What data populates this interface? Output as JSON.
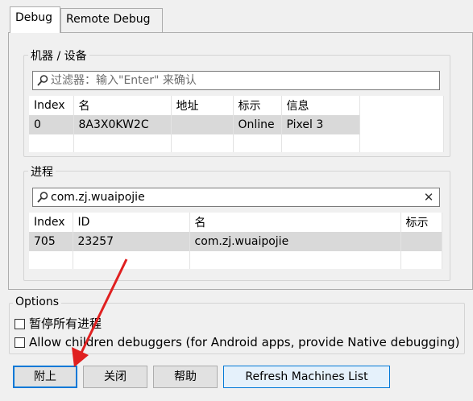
{
  "tabs": [
    {
      "label": "Debug",
      "active": true
    },
    {
      "label": "Remote Debug",
      "active": false
    }
  ],
  "machines": {
    "title": "机器 / 设备",
    "filter_placeholder": "过滤器：输入\"Enter\" 来确认",
    "columns": [
      "Index",
      "名",
      "地址",
      "标示",
      "信息"
    ],
    "rows": [
      {
        "index": "0",
        "name": "8A3X0KW2C",
        "address": "",
        "mark": "Online",
        "info": "Pixel 3"
      }
    ]
  },
  "processes": {
    "title": "进程",
    "filter_value": "com.zj.wuaipojie",
    "columns": [
      "Index",
      "ID",
      "名",
      "标示"
    ],
    "rows": [
      {
        "index": "705",
        "id": "23257",
        "name": "com.zj.wuaipojie",
        "mark": ""
      }
    ]
  },
  "options": {
    "title": "Options",
    "pause_all": {
      "label": "暂停所有进程",
      "checked": false
    },
    "allow_children": {
      "label": "Allow children debuggers (for Android apps, provide Native debugging)",
      "checked": false
    }
  },
  "buttons": {
    "attach": "附上",
    "close": "关闭",
    "help": "帮助",
    "refresh": "Refresh Machines List"
  },
  "annotation": {
    "arrow_color": "#e02020"
  },
  "colors": {
    "selected_row": "#d9d9d9",
    "focus_border": "#0078d7",
    "window_bg": "#f0f0f0"
  }
}
